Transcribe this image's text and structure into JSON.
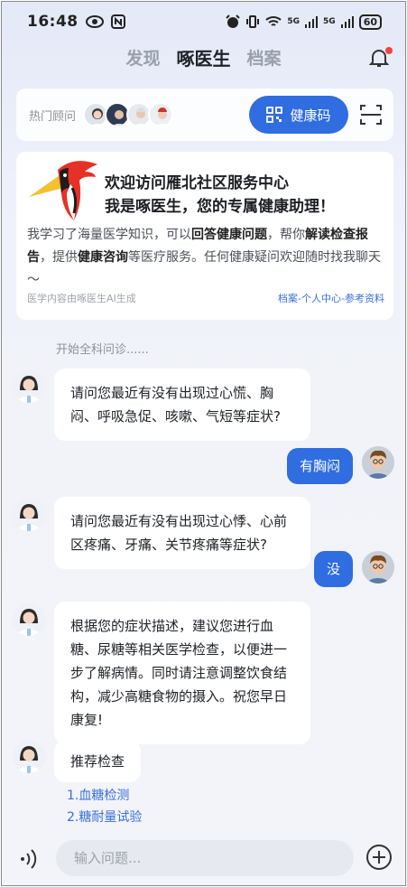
{
  "status": {
    "time": "16:48",
    "battery": "60",
    "net_a": "5G",
    "net_b": "5G"
  },
  "tabs": [
    {
      "label": "发现"
    },
    {
      "label": "啄医生"
    },
    {
      "label": "档案"
    }
  ],
  "consult": {
    "label": "热门顾问",
    "health_code": "健康码"
  },
  "welcome": {
    "title1": "欢迎访问雁北社区服务中心",
    "title2": "我是啄医生，您的专属健康助理！",
    "body_1": "我学习了海量医学知识，可以",
    "body_b1": "回答健康问题",
    "body_2": "，帮你",
    "body_b2": "解读检查报告",
    "body_3": "，提供",
    "body_b3": "健康咨询",
    "body_4": "等医疗服务。任何健康疑问欢迎随时找我聊天～",
    "note": "医学内容由啄医生AI生成",
    "link": "档案-个人中心-参考资料"
  },
  "chat": {
    "start_tip": "开始全科问诊......",
    "msg1": "请问您最近有没有出现过心慌、胸闷、呼吸急促、咳嗽、气短等症状?",
    "reply1": "有胸闷",
    "msg2": "请问您最近有没有出现过心悸、心前区疼痛、牙痛、关节疼痛等症状?",
    "reply2": "没",
    "msg3": "根据您的症状描述，建议您进行血糖、尿糖等相关医学检查，以便进一步了解病情。同时请注意调整饮食结构，减少高糖食物的摄入。祝您早日康复!",
    "msg4": "推荐检查",
    "rec1": "1.血糖检测",
    "rec2": "2.糖耐量试验"
  },
  "input": {
    "placeholder": "输入问题..."
  },
  "colors": {
    "accent": "#2f6de0",
    "link": "#3a6fd6",
    "notify": "#f0443a"
  }
}
